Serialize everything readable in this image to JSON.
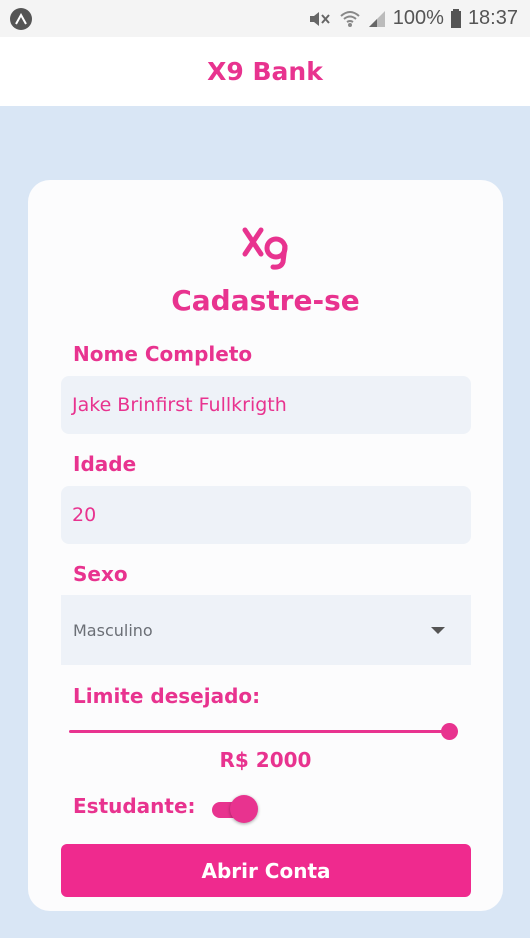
{
  "status_bar": {
    "battery_percent": "100%",
    "time": "18:37",
    "app_icon": "android-robot-icon"
  },
  "header": {
    "title": "X9 Bank"
  },
  "form": {
    "logo_text": "X9",
    "title": "Cadastre-se",
    "name_label": "Nome Completo",
    "name_value": "Jake Brinfirst Fullkrigth",
    "age_label": "Idade",
    "age_value": "20",
    "sex_label": "Sexo",
    "sex_value": "Masculino",
    "limit_label": "Limite desejado:",
    "limit_fraction": 1.0,
    "limit_value_text": "R$ 2000",
    "student_label": "Estudante:",
    "student_on": true,
    "submit_label": "Abrir Conta"
  },
  "colors": {
    "accent": "#e8338f",
    "button": "#ef2a8e",
    "background": "#d9e6f5",
    "field_background": "#eef2f8"
  }
}
